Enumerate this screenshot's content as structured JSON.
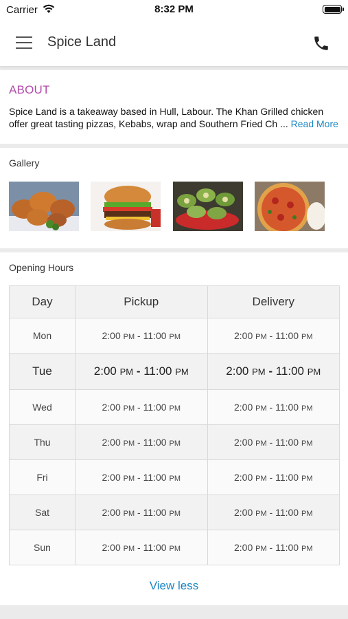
{
  "status_bar": {
    "carrier": "Carrier",
    "time": "8:32 PM"
  },
  "nav": {
    "title": "Spice Land"
  },
  "about": {
    "heading": "ABOUT",
    "text": "Spice Land is a takeaway based in Hull, Labour. The Khan Grilled chicken offer great tasting pizzas, Kebabs, wrap and Southern Fried Ch ...",
    "read_more": "Read More"
  },
  "gallery": {
    "label": "Gallery",
    "images": [
      "fried-chicken",
      "burger",
      "wraps",
      "pizza"
    ]
  },
  "opening_hours": {
    "label": "Opening Hours",
    "columns": [
      "Day",
      "Pickup",
      "Delivery"
    ],
    "rows": [
      {
        "day": "Mon",
        "pickup_from": "2:00",
        "pickup_from_ap": "PM",
        "pickup_to": "11:00",
        "pickup_to_ap": "PM",
        "delivery_from": "2:00",
        "delivery_from_ap": "PM",
        "delivery_to": "11:00",
        "delivery_to_ap": "PM"
      },
      {
        "day": "Tue",
        "pickup_from": "2:00",
        "pickup_from_ap": "PM",
        "pickup_to": "11:00",
        "pickup_to_ap": "PM",
        "delivery_from": "2:00",
        "delivery_from_ap": "PM",
        "delivery_to": "11:00",
        "delivery_to_ap": "PM"
      },
      {
        "day": "Wed",
        "pickup_from": "2:00",
        "pickup_from_ap": "PM",
        "pickup_to": "11:00",
        "pickup_to_ap": "PM",
        "delivery_from": "2:00",
        "delivery_from_ap": "PM",
        "delivery_to": "11:00",
        "delivery_to_ap": "PM"
      },
      {
        "day": "Thu",
        "pickup_from": "2:00",
        "pickup_from_ap": "PM",
        "pickup_to": "11:00",
        "pickup_to_ap": "PM",
        "delivery_from": "2:00",
        "delivery_from_ap": "PM",
        "delivery_to": "11:00",
        "delivery_to_ap": "PM"
      },
      {
        "day": "Fri",
        "pickup_from": "2:00",
        "pickup_from_ap": "PM",
        "pickup_to": "11:00",
        "pickup_to_ap": "PM",
        "delivery_from": "2:00",
        "delivery_from_ap": "PM",
        "delivery_to": "11:00",
        "delivery_to_ap": "PM"
      },
      {
        "day": "Sat",
        "pickup_from": "2:00",
        "pickup_from_ap": "PM",
        "pickup_to": "11:00",
        "pickup_to_ap": "PM",
        "delivery_from": "2:00",
        "delivery_from_ap": "PM",
        "delivery_to": "11:00",
        "delivery_to_ap": "PM"
      },
      {
        "day": "Sun",
        "pickup_from": "2:00",
        "pickup_from_ap": "PM",
        "pickup_to": "11:00",
        "pickup_to_ap": "PM",
        "delivery_from": "2:00",
        "delivery_from_ap": "PM",
        "delivery_to": "11:00",
        "delivery_to_ap": "PM"
      }
    ],
    "view_less": "View less"
  },
  "colors": {
    "accent_about": "#b24aa8",
    "link": "#1a86c4"
  },
  "icons": [
    "wifi-icon",
    "battery-icon",
    "menu-icon",
    "phone-icon"
  ]
}
